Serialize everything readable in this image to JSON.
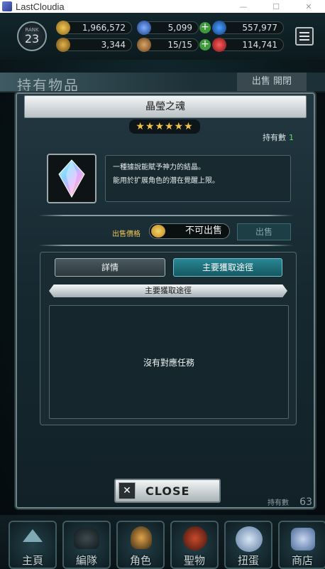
{
  "window": {
    "title": "LastCloudia",
    "minimize": "—",
    "maximize": "☐",
    "close": "✕"
  },
  "hud": {
    "rank_label": "RANK",
    "rank": "23",
    "gold": "1,966,572",
    "crystals": "5,099",
    "blue_resource": "557,977",
    "trophies": "3,344",
    "stamina": "15/15",
    "red_resource": "114,741"
  },
  "background": {
    "section_title": "持有物品",
    "sell_toggle": "出售 開閉",
    "owned_count_label": "持有數",
    "owned_count_value": "63"
  },
  "dialog": {
    "title": "晶瑩之魂",
    "rarity_stars": 6,
    "owned_label": "持有數",
    "owned_count": "1",
    "description_line1": "一種據說能賦予神力的結晶。",
    "description_line2": "能用於扩展角色的潜在覺醒上限。",
    "sell_price_label": "出售價格",
    "sell_price_value": "不可出售",
    "sell_button": "出售",
    "tab_details": "詳情",
    "tab_acquisition": "主要獲取途徑",
    "section_header": "主要獲取途徑",
    "empty_message": "沒有對應任務",
    "close_button": "CLOSE"
  },
  "nav": [
    {
      "label": "主頁",
      "icon": "home-icon"
    },
    {
      "label": "編隊",
      "icon": "party-icon"
    },
    {
      "label": "角色",
      "icon": "character-icon"
    },
    {
      "label": "聖物",
      "icon": "relic-icon"
    },
    {
      "label": "扭蛋",
      "icon": "gacha-icon"
    },
    {
      "label": "商店",
      "icon": "shop-icon"
    }
  ],
  "colors": {
    "accent_teal": "#2a8794",
    "gold_text": "#f2c657",
    "owned_green": "#66d96a"
  }
}
